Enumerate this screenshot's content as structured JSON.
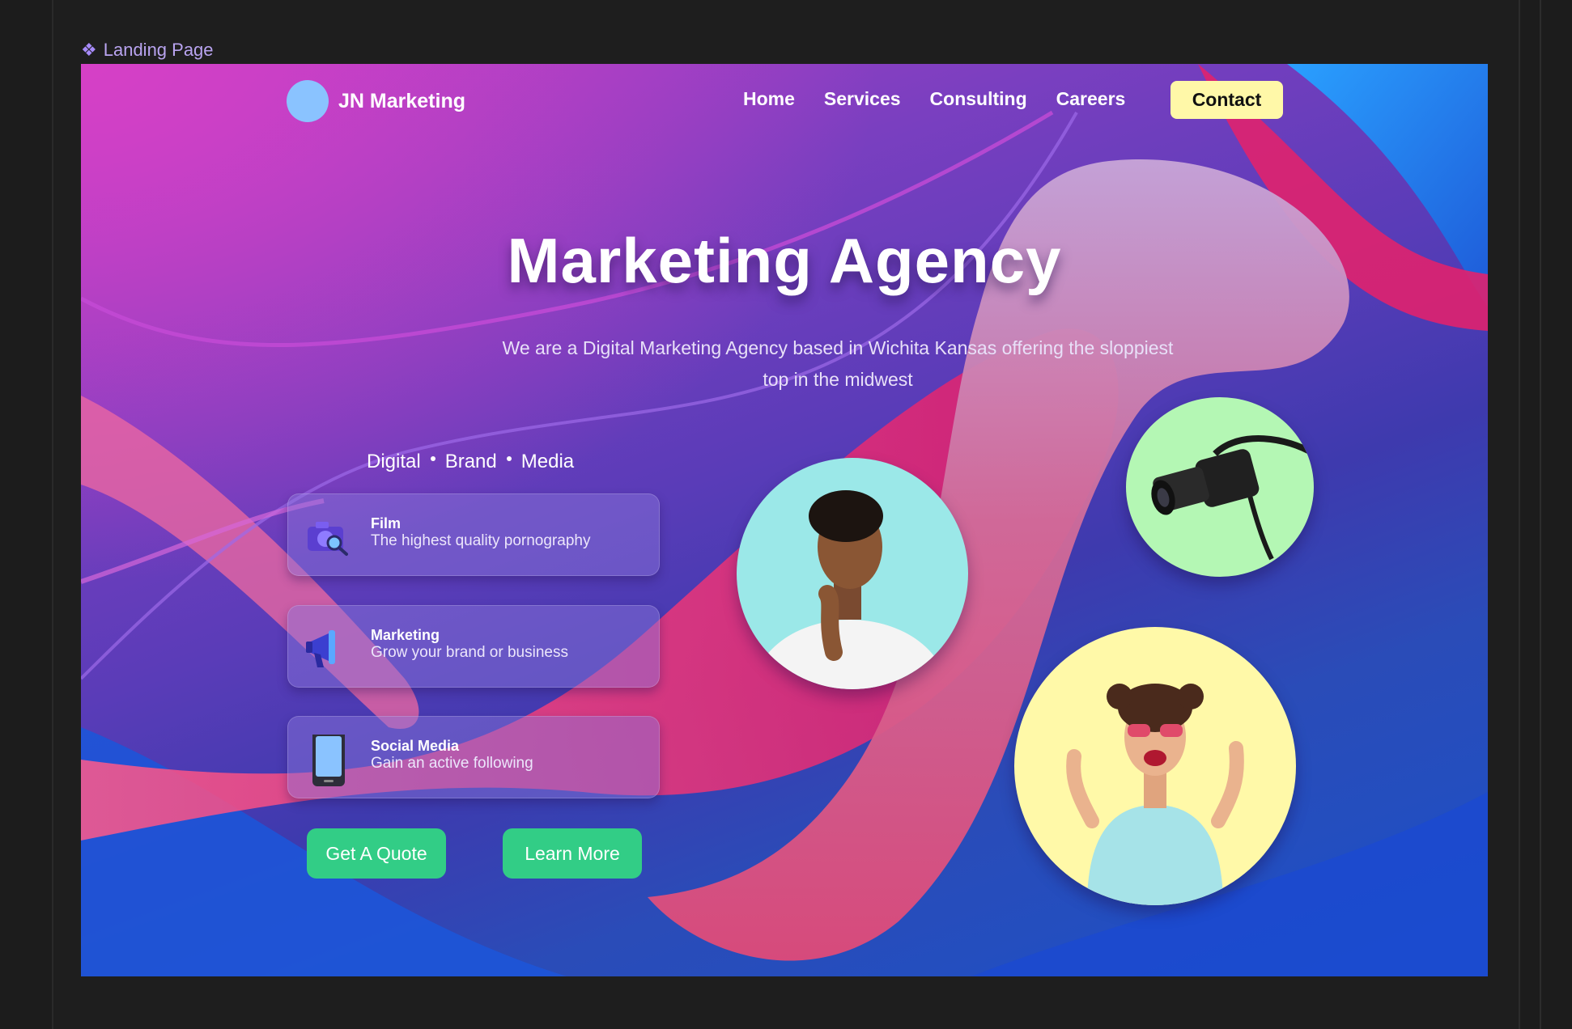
{
  "editor": {
    "frame_label": "Landing Page",
    "frame_icon": "component-diamond-icon"
  },
  "nav": {
    "brand_name": "JN Marketing",
    "links": [
      "Home",
      "Services",
      "Consulting",
      "Careers"
    ],
    "contact_label": "Contact"
  },
  "hero": {
    "title": "Marketing Agency",
    "subtitle_line1": "We are a Digital Marketing Agency based in Wichita Kansas offering the sloppiest",
    "subtitle_line2": "top in the midwest"
  },
  "tagline": [
    "Digital",
    "Brand",
    "Media"
  ],
  "services": [
    {
      "title": "Film",
      "description": "The highest quality pornography",
      "icon": "camera-icon"
    },
    {
      "title": "Marketing",
      "description": "Grow your brand or business",
      "icon": "megaphone-icon"
    },
    {
      "title": "Social Media",
      "description": "Gain an active following",
      "icon": "phone-icon"
    }
  ],
  "actions": {
    "quote_label": "Get A Quote",
    "learn_label": "Learn More"
  },
  "colors": {
    "accent_green": "#32cd86",
    "contact_yellow": "#fff8a8",
    "logo_blue": "#8ac3ff",
    "photo_cyan": "#9be8e8",
    "photo_green": "#b4f7b4",
    "photo_yellow": "#fff9a8"
  }
}
